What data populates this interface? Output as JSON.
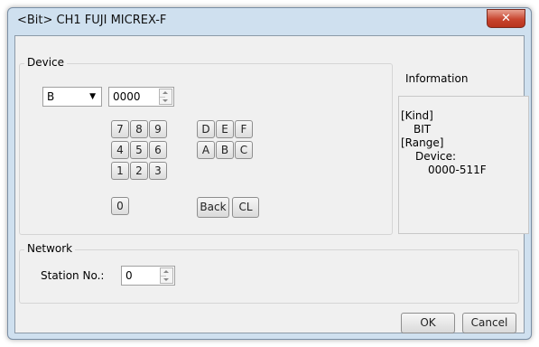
{
  "window": {
    "title": "<Bit> CH1 FUJI MICREX-F",
    "close_symbol": "✕"
  },
  "device": {
    "group_label": "Device",
    "type_value": "B",
    "address_value": "0000",
    "keypad": {
      "digits": [
        "7",
        "8",
        "9",
        "4",
        "5",
        "6",
        "1",
        "2",
        "3",
        "0"
      ],
      "hex": [
        "D",
        "E",
        "F",
        "A",
        "B",
        "C"
      ],
      "back_label": "Back",
      "clear_label": "CL"
    }
  },
  "information": {
    "label": "Information",
    "kind_header": "[Kind]",
    "kind_value": "BIT",
    "range_header": "[Range]",
    "range_sub": "Device:",
    "range_value": "0000-511F"
  },
  "network": {
    "group_label": "Network",
    "station_label": "Station No.:",
    "station_value": "0"
  },
  "buttons": {
    "ok": "OK",
    "cancel": "Cancel"
  },
  "icons": {
    "close": "close-icon",
    "dropdown": "chevron-down-icon",
    "spin": "spin-arrows-icon"
  }
}
